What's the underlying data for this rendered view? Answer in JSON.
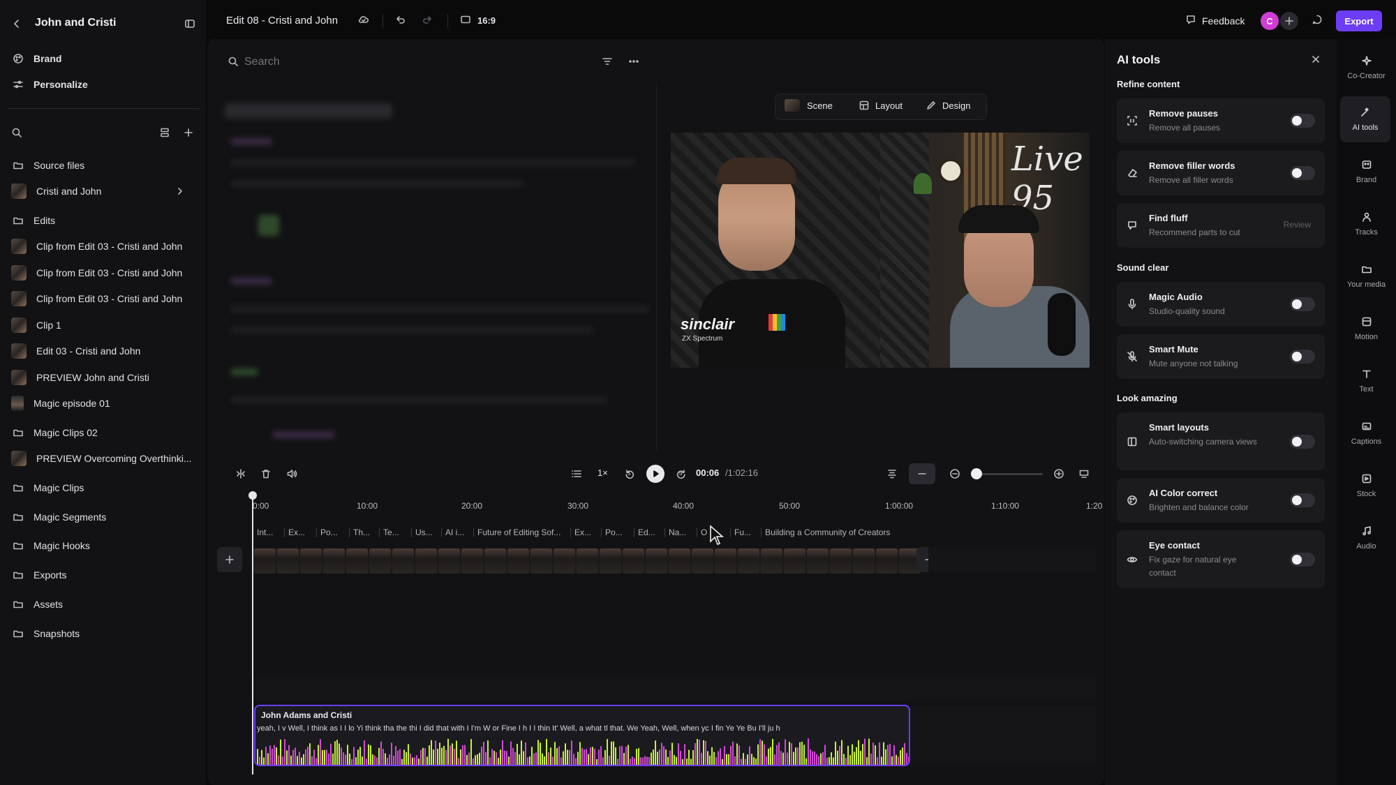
{
  "project": {
    "title": "John and Cristi"
  },
  "sidebar": {
    "top_items": [
      {
        "label": "Brand",
        "icon": "palette-icon"
      },
      {
        "label": "Personalize",
        "icon": "sliders-icon"
      }
    ],
    "files": [
      {
        "label": "Source files",
        "type": "folder"
      },
      {
        "label": "Cristi and John",
        "type": "clip"
      },
      {
        "label": "Edits",
        "type": "folder"
      },
      {
        "label": "Clip from Edit 03 - Cristi and John",
        "type": "clip"
      },
      {
        "label": "Clip from Edit 03 - Cristi and John",
        "type": "clip"
      },
      {
        "label": "Clip from Edit 03 - Cristi and John",
        "type": "clip"
      },
      {
        "label": "Clip 1",
        "type": "clip"
      },
      {
        "label": "Edit 03 - Cristi and John",
        "type": "clip"
      },
      {
        "label": "PREVIEW John and Cristi",
        "type": "clip"
      },
      {
        "label": "Magic episode 01",
        "type": "solo"
      },
      {
        "label": "Magic Clips 02",
        "type": "folder"
      },
      {
        "label": "PREVIEW Overcoming Overthinki...",
        "type": "clip"
      },
      {
        "label": "Magic Clips",
        "type": "folder"
      },
      {
        "label": "Magic Segments",
        "type": "folder"
      },
      {
        "label": "Magic Hooks",
        "type": "folder"
      },
      {
        "label": "Exports",
        "type": "folder"
      },
      {
        "label": "Assets",
        "type": "folder"
      },
      {
        "label": "Snapshots",
        "type": "folder"
      }
    ]
  },
  "header": {
    "edit_title": "Edit 08 - Cristi and John",
    "aspect": "16:9",
    "feedback": "Feedback",
    "avatar_initial": "C",
    "export": "Export"
  },
  "script": {
    "search_placeholder": "Search"
  },
  "preview": {
    "tabs": [
      {
        "label": "Scene"
      },
      {
        "label": "Layout"
      },
      {
        "label": "Design"
      }
    ],
    "shirt_text": "sinclair",
    "shirt_sub": "ZX Spectrum",
    "sign_text": "Live 95"
  },
  "playback": {
    "speed": "1×",
    "current": "00:06",
    "total": "/1:02:16",
    "skip_back": "5",
    "skip_fwd": "5"
  },
  "timeline": {
    "ruler": [
      "0:00",
      "10:00",
      "20:00",
      "30:00",
      "40:00",
      "50:00",
      "1:00:00",
      "1:10:00",
      "1:20"
    ],
    "chapters": [
      "Int...",
      "Ex...",
      "Po...",
      "Th...",
      "Te...",
      "Us...",
      "AI i...",
      "Future of Editing Sof...",
      "Ex...",
      "Po...",
      "Ed...",
      "Na...",
      "O",
      "Fu...",
      "Building a Community of Creators"
    ],
    "audio_track_name": "John Adams and Cristi",
    "transcript": [
      "yeah, I v",
      "Well, I think as I",
      "I lo",
      "Yi",
      "think tha",
      "the thi",
      "I did that with I",
      "I'm",
      "W",
      "or",
      "Fine I h",
      "I I thin",
      "It'",
      "Well, a",
      "what tl",
      "that.",
      "We",
      "Yeah,",
      "Well,",
      "when yc",
      "I fin",
      "Ye",
      "Ye",
      "Bu",
      "I'll ju",
      "h"
    ],
    "waveform_colors": [
      "#d34bd8",
      "#c6f23c"
    ]
  },
  "ai_tools": {
    "title": "AI tools",
    "sections": [
      {
        "title": "Refine content",
        "items": [
          {
            "title": "Remove pauses",
            "sub": "Remove all pauses",
            "control": "toggle"
          },
          {
            "title": "Remove filler words",
            "sub": "Remove all filler words",
            "control": "toggle"
          },
          {
            "title": "Find fluff",
            "sub": "Recommend parts to cut",
            "control": "Review"
          }
        ]
      },
      {
        "title": "Sound clear",
        "items": [
          {
            "title": "Magic Audio",
            "sub": "Studio-quality sound",
            "control": "toggle"
          },
          {
            "title": "Smart Mute",
            "sub": "Mute anyone not talking",
            "control": "toggle"
          }
        ]
      },
      {
        "title": "Look amazing",
        "items": [
          {
            "title": "Smart layouts",
            "sub": "Auto-switching camera views",
            "control": "toggle"
          },
          {
            "title": "AI Color correct",
            "sub": "Brighten and balance color",
            "control": "toggle"
          },
          {
            "title": "Eye contact",
            "sub": "Fix gaze for natural eye contact",
            "control": "toggle"
          }
        ]
      }
    ]
  },
  "rail": [
    {
      "label": "Co-Creator",
      "icon": "sparkle-icon"
    },
    {
      "label": "AI tools",
      "icon": "magic-wand-icon",
      "active": true
    },
    {
      "label": "Brand",
      "icon": "palette-icon"
    },
    {
      "label": "Tracks",
      "icon": "people-icon"
    },
    {
      "label": "Your media",
      "icon": "folder-icon"
    },
    {
      "label": "Motion",
      "icon": "motion-icon"
    },
    {
      "label": "Text",
      "icon": "text-icon"
    },
    {
      "label": "Captions",
      "icon": "captions-icon"
    },
    {
      "label": "Stock",
      "icon": "stock-icon"
    },
    {
      "label": "Audio",
      "icon": "music-note-icon"
    }
  ],
  "colors": {
    "accent": "#6d3df5",
    "avatar": "#d23cd6",
    "background": "#0a0a0b",
    "panel": "#121214"
  }
}
